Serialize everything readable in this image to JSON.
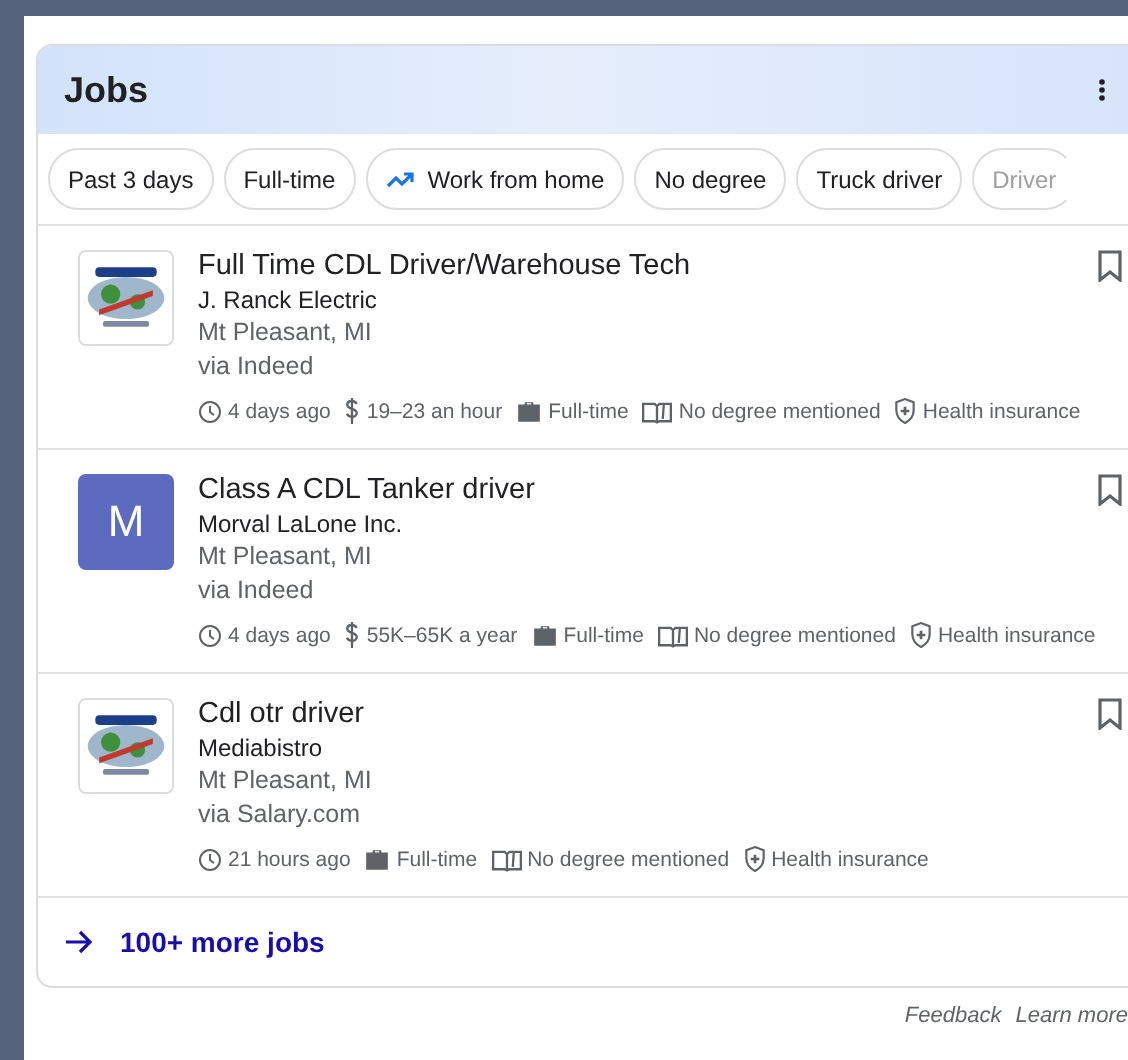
{
  "header": {
    "title": "Jobs"
  },
  "chips": [
    {
      "label": "Past 3 days",
      "kind": "plain"
    },
    {
      "label": "Full-time",
      "kind": "plain"
    },
    {
      "label": "Work from home",
      "kind": "trending"
    },
    {
      "label": "No degree",
      "kind": "plain"
    },
    {
      "label": "Truck driver",
      "kind": "plain"
    },
    {
      "label": "Driver",
      "kind": "faded"
    }
  ],
  "jobs": [
    {
      "title": "Full Time CDL Driver/Warehouse Tech",
      "company": "J. Ranck Electric",
      "location": "Mt Pleasant, MI",
      "source": "via Indeed",
      "logo": {
        "kind": "picture"
      },
      "meta": [
        {
          "kind": "time",
          "text": "4 days ago"
        },
        {
          "kind": "pay",
          "text": "19–23 an hour"
        },
        {
          "kind": "type",
          "text": "Full-time"
        },
        {
          "kind": "degree",
          "text": "No degree mentioned"
        },
        {
          "kind": "health",
          "text": "Health insurance"
        }
      ]
    },
    {
      "title": "Class A CDL Tanker driver",
      "company": "Morval LaLone Inc.",
      "location": "Mt Pleasant, MI",
      "source": "via Indeed",
      "logo": {
        "kind": "letter",
        "letter": "M",
        "color": "#5c6bc0"
      },
      "meta": [
        {
          "kind": "time",
          "text": "4 days ago"
        },
        {
          "kind": "pay",
          "text": "55K–65K a year"
        },
        {
          "kind": "type",
          "text": "Full-time"
        },
        {
          "kind": "degree",
          "text": "No degree mentioned"
        },
        {
          "kind": "health",
          "text": "Health insurance"
        }
      ]
    },
    {
      "title": "Cdl otr driver",
      "company": "Mediabistro",
      "location": "Mt Pleasant, MI",
      "source": "via Salary.com",
      "logo": {
        "kind": "picture"
      },
      "meta": [
        {
          "kind": "time",
          "text": "21 hours ago"
        },
        {
          "kind": "type",
          "text": "Full-time"
        },
        {
          "kind": "degree",
          "text": "No degree mentioned"
        },
        {
          "kind": "health",
          "text": "Health insurance"
        }
      ]
    }
  ],
  "more": {
    "label": "100+ more jobs"
  },
  "footer": {
    "links": [
      "Feedback",
      "Learn more"
    ]
  }
}
